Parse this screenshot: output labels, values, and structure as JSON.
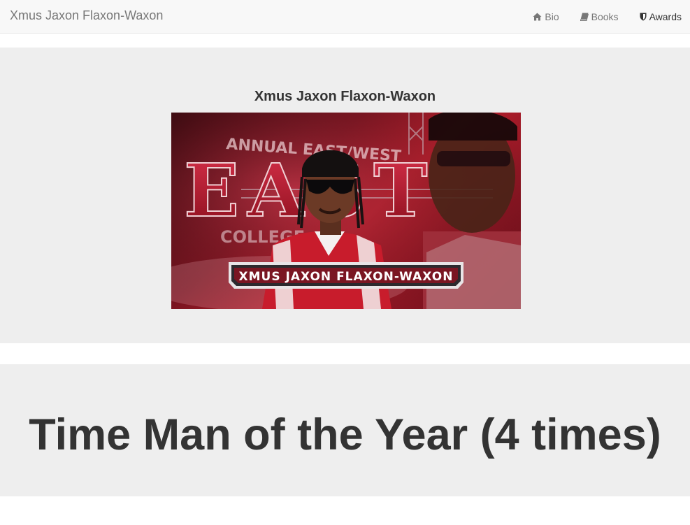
{
  "navbar": {
    "brand": "Xmus Jaxon Flaxon-Waxon",
    "items": [
      {
        "label": "Bio",
        "icon": "home-icon"
      },
      {
        "label": "Books",
        "icon": "book-icon"
      },
      {
        "label": "Awards",
        "icon": "shield-icon",
        "active": true
      }
    ]
  },
  "profile": {
    "name": "Xmus Jaxon Flaxon-Waxon",
    "image": {
      "sign_text": "ANNUAL EAST/WEST",
      "big_text": "EAST",
      "sub_text": "COLLEGE",
      "banner_text": "XMUS JAXON FLAXON-WAXON"
    }
  },
  "award": {
    "title": "Time Man of the Year (4 times)"
  },
  "colors": {
    "navbar_bg": "#f8f8f8",
    "jumbotron_bg": "#eeeeee",
    "text": "#333333",
    "nav_text": "#777777"
  }
}
